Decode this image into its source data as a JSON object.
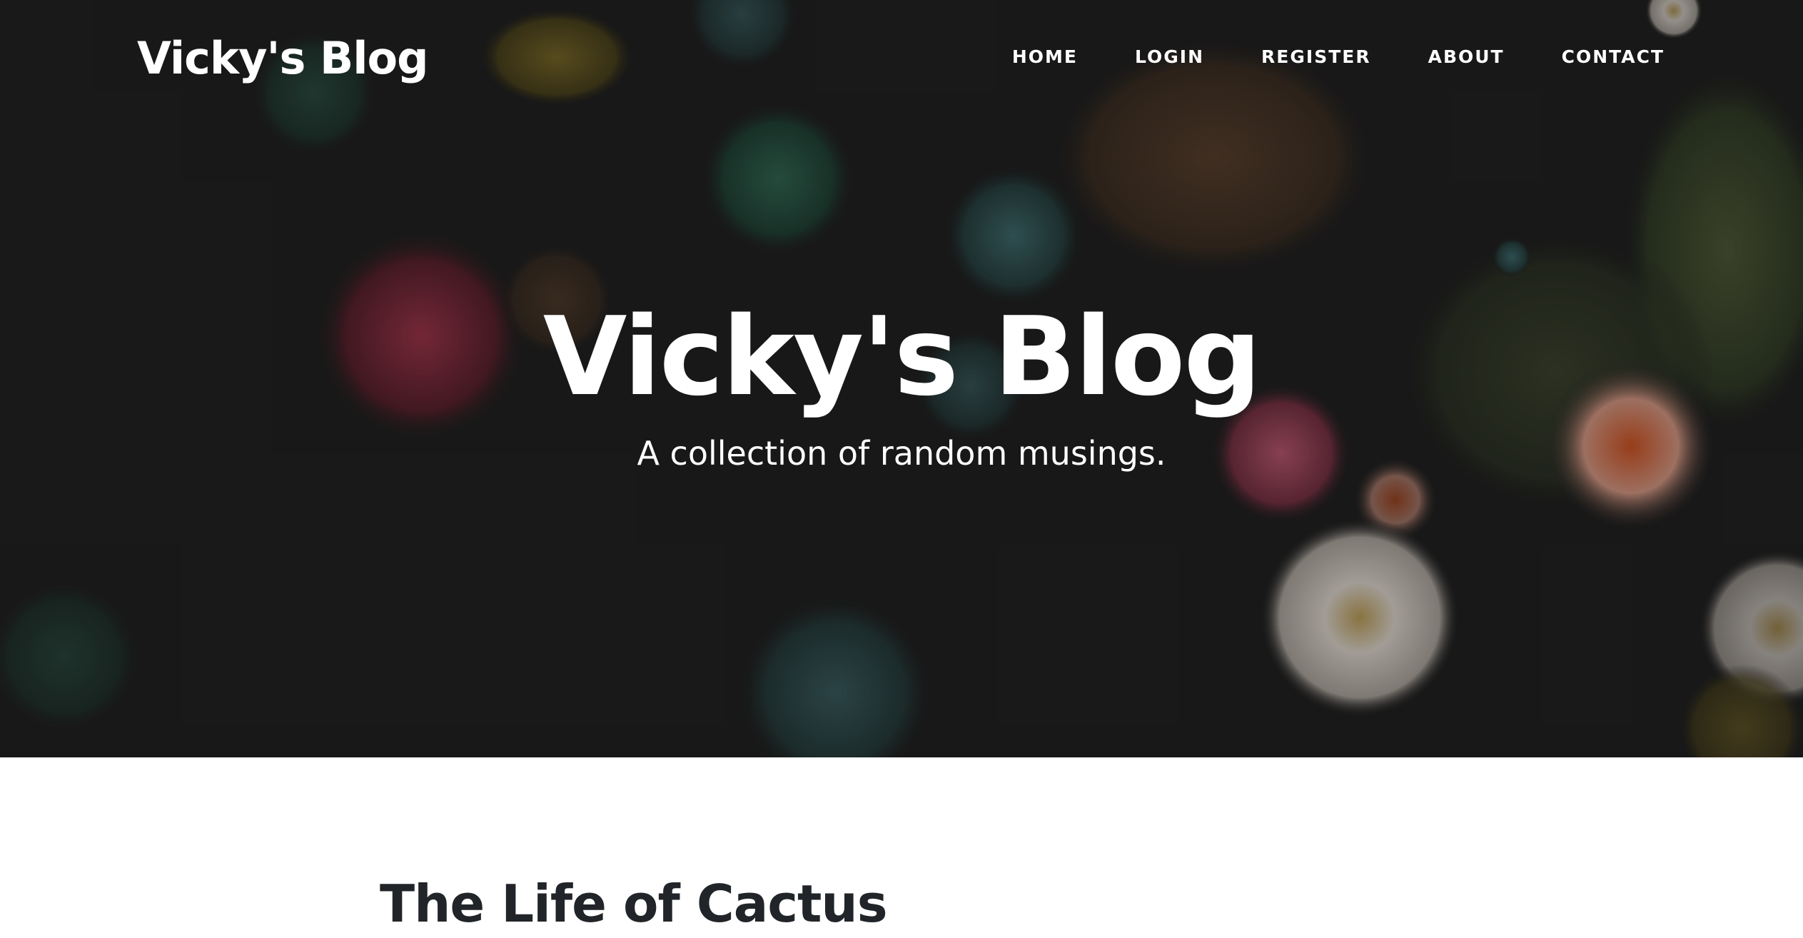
{
  "brand": {
    "name": "Vicky's Blog"
  },
  "nav": {
    "items": [
      {
        "label": "HOME"
      },
      {
        "label": "LOGIN"
      },
      {
        "label": "REGISTER"
      },
      {
        "label": "ABOUT"
      },
      {
        "label": "CONTACT"
      }
    ]
  },
  "hero": {
    "title": "Vicky's Blog",
    "subtitle": "A collection of random musings.",
    "background": "sea-anemones-photo"
  },
  "posts": [
    {
      "title": "The Life of Cactus"
    }
  ],
  "colors": {
    "hero_dark": "#1b1b1b",
    "text_light": "#ffffff",
    "post_title": "#212529"
  }
}
